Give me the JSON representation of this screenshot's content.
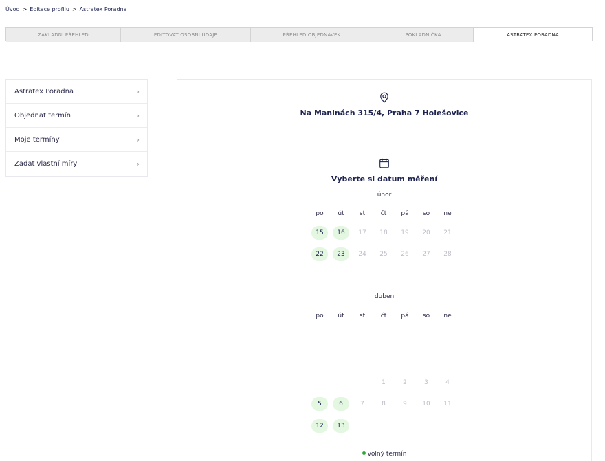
{
  "breadcrumb": {
    "items": [
      "Úvod",
      "Editace profilu",
      "Astratex Poradna"
    ],
    "separator": ">"
  },
  "tabs": [
    {
      "label": "ZÁKLADNÍ PŘEHLED",
      "active": false
    },
    {
      "label": "EDITOVAT OSOBNÍ ÚDAJE",
      "active": false
    },
    {
      "label": "PŘEHLED OBJEDNÁVEK",
      "active": false
    },
    {
      "label": "POKLADNIČKA",
      "active": false
    },
    {
      "label": "ASTRATEX PORADNA",
      "active": true
    }
  ],
  "sidebar": {
    "items": [
      {
        "label": "Astratex Poradna"
      },
      {
        "label": "Objednat termín"
      },
      {
        "label": "Moje termíny"
      },
      {
        "label": "Zadat vlastní míry"
      }
    ],
    "chevron": "›"
  },
  "location": {
    "icon": "location-pin-icon",
    "address": "Na Maninách 315/4, Praha 7 Holešovice"
  },
  "calendar": {
    "icon": "calendar-icon",
    "title": "Vyberte si datum měření",
    "weekdays": [
      "po",
      "út",
      "st",
      "čt",
      "pá",
      "so",
      "ne"
    ],
    "months": [
      {
        "name": "únor",
        "weeks": [
          [
            {
              "d": "15",
              "s": "free"
            },
            {
              "d": "16",
              "s": "free"
            },
            {
              "d": "17",
              "s": "off"
            },
            {
              "d": "18",
              "s": "off"
            },
            {
              "d": "19",
              "s": "off"
            },
            {
              "d": "20",
              "s": "off"
            },
            {
              "d": "21",
              "s": "off"
            }
          ],
          [
            {
              "d": "22",
              "s": "free"
            },
            {
              "d": "23",
              "s": "free"
            },
            {
              "d": "24",
              "s": "off"
            },
            {
              "d": "25",
              "s": "off"
            },
            {
              "d": "26",
              "s": "off"
            },
            {
              "d": "27",
              "s": "off"
            },
            {
              "d": "28",
              "s": "off"
            }
          ]
        ]
      },
      {
        "name": "duben",
        "weeks": [
          [
            {
              "d": "",
              "s": "empty"
            },
            {
              "d": "",
              "s": "empty"
            },
            {
              "d": "",
              "s": "empty"
            },
            {
              "d": "1",
              "s": "off"
            },
            {
              "d": "2",
              "s": "off"
            },
            {
              "d": "3",
              "s": "off"
            },
            {
              "d": "4",
              "s": "off"
            }
          ],
          [
            {
              "d": "5",
              "s": "free"
            },
            {
              "d": "6",
              "s": "free"
            },
            {
              "d": "7",
              "s": "off"
            },
            {
              "d": "8",
              "s": "off"
            },
            {
              "d": "9",
              "s": "off"
            },
            {
              "d": "10",
              "s": "off"
            },
            {
              "d": "11",
              "s": "off"
            }
          ],
          [
            {
              "d": "12",
              "s": "free"
            },
            {
              "d": "13",
              "s": "free"
            }
          ]
        ]
      }
    ],
    "legend": "volný termín",
    "colors": {
      "free_bg": "#e3f7e1",
      "legend_dot": "#2fa83a",
      "off_text": "#bdbdc8"
    }
  }
}
